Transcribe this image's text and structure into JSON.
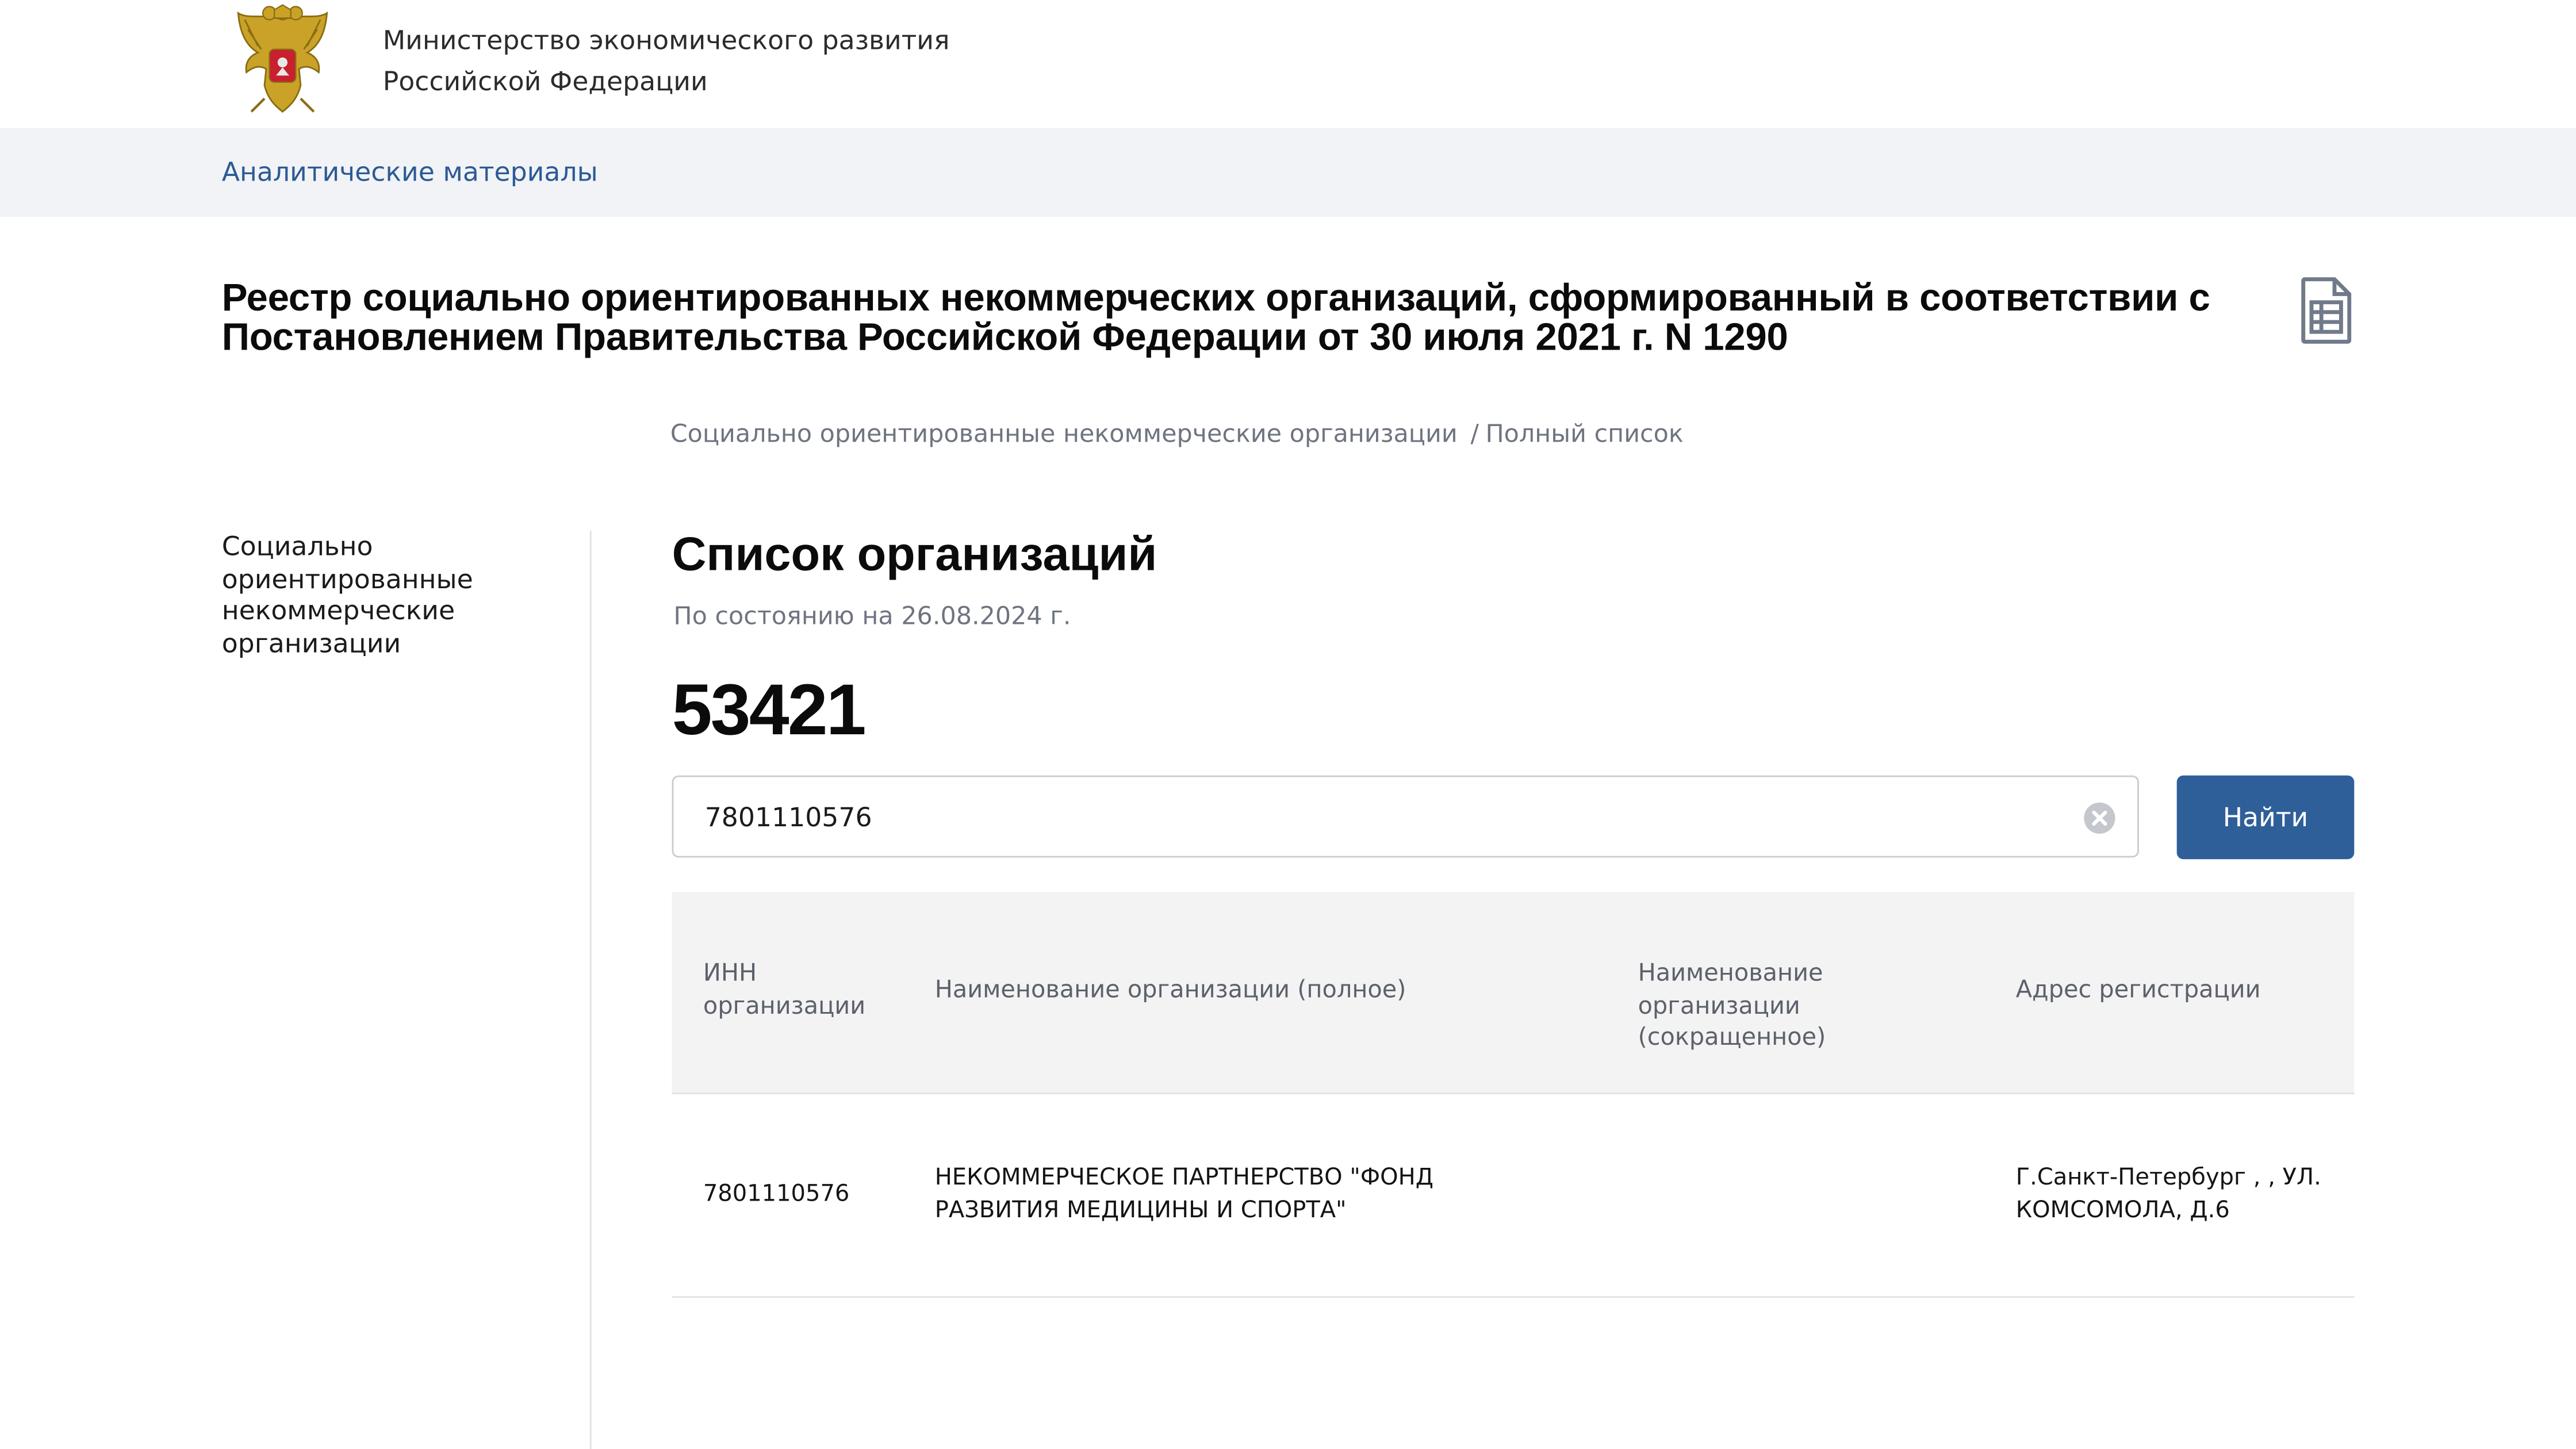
{
  "header": {
    "ministry_line1": "Министерство экономического развития",
    "ministry_line2": "Российской Федерации",
    "emblem": "russian-coat-of-arms"
  },
  "subnav": {
    "link_label": "Аналитические материалы"
  },
  "page": {
    "title": "Реестр социально ориентированных некоммерческих организаций, сформированный в соответствии с Постановлением Правительства Российской Федерации от 30 июля 2021 г. N 1290",
    "doc_icon": "spreadsheet-document-icon"
  },
  "breadcrumb": {
    "items": [
      {
        "label": "Социально ориентированные некоммерческие организации"
      },
      {
        "label": "Полный список"
      }
    ],
    "separator": "/"
  },
  "sidebar": {
    "item_label": "Социально ориентированные некоммерческие организации"
  },
  "main": {
    "list_title": "Список организаций",
    "as_of": "По состоянию на 26.08.2024 г.",
    "count": "53421"
  },
  "search": {
    "value": "7801110576",
    "button_label": "Найти",
    "clear_icon": "clear-circle-icon"
  },
  "table": {
    "headers": [
      "ИНН организации",
      "Наименование организации (полное)",
      "Наименование организации (сокращенное)",
      "Адрес регистрации"
    ],
    "rows": [
      {
        "inn": "7801110576",
        "full_name": "НЕКОММЕРЧЕСКОЕ ПАРТНЕРСТВО \"ФОНД РАЗВИТИЯ МЕДИЦИНЫ И СПОРТА\"",
        "short_name": "",
        "address": "Г.Санкт-Петербург , , УЛ. КОМСОМОЛА, Д.6"
      }
    ]
  },
  "colors": {
    "accent": "#2f5f99",
    "link": "#2d5a94",
    "subnav_bg": "#f1f3f6",
    "table_head_bg": "#f3f3f3",
    "muted_text": "#6f7480"
  }
}
